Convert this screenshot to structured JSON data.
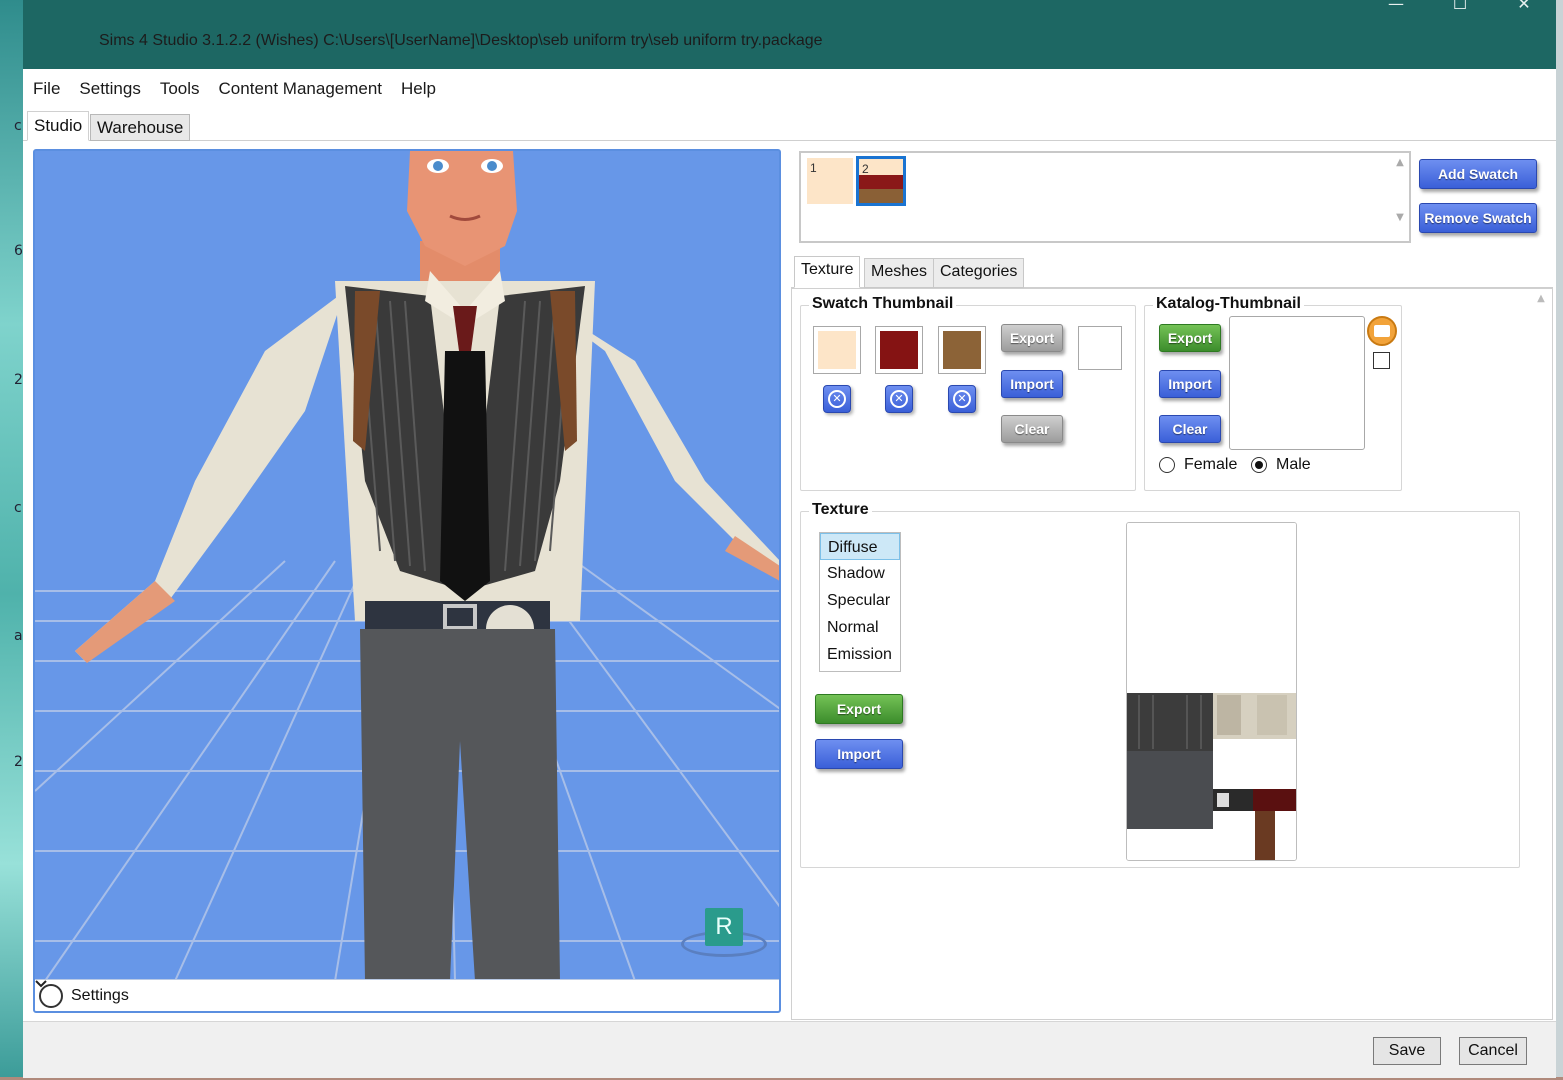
{
  "window": {
    "title": "Sims 4 Studio 3.1.2.2 (Wishes)  C:\\Users\\[UserName]\\Desktop\\seb uniform try\\seb uniform try.package",
    "minimize_glyph": "—",
    "maximize_glyph": "☐",
    "close_glyph": "✕"
  },
  "menu": [
    "File",
    "Settings",
    "Tools",
    "Content Management",
    "Help"
  ],
  "tabs": {
    "studio": "Studio",
    "warehouse": "Warehouse"
  },
  "viewport": {
    "settings_label": "Settings",
    "badge": "R",
    "background": "#6797e8"
  },
  "swatches": {
    "items": [
      {
        "number": "1",
        "color": "#fde5c8"
      },
      {
        "number": "2",
        "colors": [
          "#fde5c8",
          "#8a1818",
          "#8a6036"
        ]
      }
    ],
    "add_label": "Add Swatch",
    "remove_label": "Remove Swatch"
  },
  "subtabs": [
    "Texture",
    "Meshes",
    "Categories"
  ],
  "swatch_thumbnail": {
    "title": "Swatch Thumbnail",
    "colors": [
      "#fde5c8",
      "#851313",
      "#8c6337"
    ],
    "export_label": "Export",
    "import_label": "Import",
    "clear_label": "Clear"
  },
  "katalog_thumbnail": {
    "title": "Katalog-Thumbnail",
    "export_label": "Export",
    "import_label": "Import",
    "clear_label": "Clear",
    "gender_options": [
      "Female",
      "Male"
    ],
    "selected_gender": "Male"
  },
  "texture": {
    "title": "Texture",
    "channels": [
      "Diffuse",
      "Shadow",
      "Specular",
      "Normal",
      "Emission"
    ],
    "selected_channel": "Diffuse",
    "export_label": "Export",
    "import_label": "Import"
  },
  "footer": {
    "save_label": "Save",
    "cancel_label": "Cancel"
  }
}
